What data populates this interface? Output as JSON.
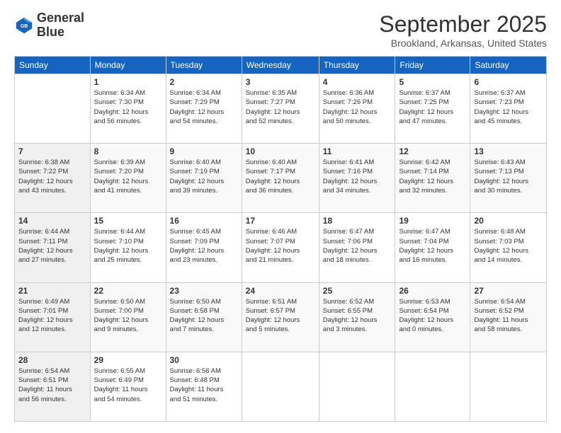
{
  "logo": {
    "line1": "General",
    "line2": "Blue"
  },
  "title": "September 2025",
  "location": "Brookland, Arkansas, United States",
  "days_of_week": [
    "Sunday",
    "Monday",
    "Tuesday",
    "Wednesday",
    "Thursday",
    "Friday",
    "Saturday"
  ],
  "weeks": [
    [
      {
        "day": "",
        "info": ""
      },
      {
        "day": "1",
        "info": "Sunrise: 6:34 AM\nSunset: 7:30 PM\nDaylight: 12 hours\nand 56 minutes."
      },
      {
        "day": "2",
        "info": "Sunrise: 6:34 AM\nSunset: 7:29 PM\nDaylight: 12 hours\nand 54 minutes."
      },
      {
        "day": "3",
        "info": "Sunrise: 6:35 AM\nSunset: 7:27 PM\nDaylight: 12 hours\nand 52 minutes."
      },
      {
        "day": "4",
        "info": "Sunrise: 6:36 AM\nSunset: 7:26 PM\nDaylight: 12 hours\nand 50 minutes."
      },
      {
        "day": "5",
        "info": "Sunrise: 6:37 AM\nSunset: 7:25 PM\nDaylight: 12 hours\nand 47 minutes."
      },
      {
        "day": "6",
        "info": "Sunrise: 6:37 AM\nSunset: 7:23 PM\nDaylight: 12 hours\nand 45 minutes."
      }
    ],
    [
      {
        "day": "7",
        "info": "Sunrise: 6:38 AM\nSunset: 7:22 PM\nDaylight: 12 hours\nand 43 minutes."
      },
      {
        "day": "8",
        "info": "Sunrise: 6:39 AM\nSunset: 7:20 PM\nDaylight: 12 hours\nand 41 minutes."
      },
      {
        "day": "9",
        "info": "Sunrise: 6:40 AM\nSunset: 7:19 PM\nDaylight: 12 hours\nand 39 minutes."
      },
      {
        "day": "10",
        "info": "Sunrise: 6:40 AM\nSunset: 7:17 PM\nDaylight: 12 hours\nand 36 minutes."
      },
      {
        "day": "11",
        "info": "Sunrise: 6:41 AM\nSunset: 7:16 PM\nDaylight: 12 hours\nand 34 minutes."
      },
      {
        "day": "12",
        "info": "Sunrise: 6:42 AM\nSunset: 7:14 PM\nDaylight: 12 hours\nand 32 minutes."
      },
      {
        "day": "13",
        "info": "Sunrise: 6:43 AM\nSunset: 7:13 PM\nDaylight: 12 hours\nand 30 minutes."
      }
    ],
    [
      {
        "day": "14",
        "info": "Sunrise: 6:44 AM\nSunset: 7:11 PM\nDaylight: 12 hours\nand 27 minutes."
      },
      {
        "day": "15",
        "info": "Sunrise: 6:44 AM\nSunset: 7:10 PM\nDaylight: 12 hours\nand 25 minutes."
      },
      {
        "day": "16",
        "info": "Sunrise: 6:45 AM\nSunset: 7:09 PM\nDaylight: 12 hours\nand 23 minutes."
      },
      {
        "day": "17",
        "info": "Sunrise: 6:46 AM\nSunset: 7:07 PM\nDaylight: 12 hours\nand 21 minutes."
      },
      {
        "day": "18",
        "info": "Sunrise: 6:47 AM\nSunset: 7:06 PM\nDaylight: 12 hours\nand 18 minutes."
      },
      {
        "day": "19",
        "info": "Sunrise: 6:47 AM\nSunset: 7:04 PM\nDaylight: 12 hours\nand 16 minutes."
      },
      {
        "day": "20",
        "info": "Sunrise: 6:48 AM\nSunset: 7:03 PM\nDaylight: 12 hours\nand 14 minutes."
      }
    ],
    [
      {
        "day": "21",
        "info": "Sunrise: 6:49 AM\nSunset: 7:01 PM\nDaylight: 12 hours\nand 12 minutes."
      },
      {
        "day": "22",
        "info": "Sunrise: 6:50 AM\nSunset: 7:00 PM\nDaylight: 12 hours\nand 9 minutes."
      },
      {
        "day": "23",
        "info": "Sunrise: 6:50 AM\nSunset: 6:58 PM\nDaylight: 12 hours\nand 7 minutes."
      },
      {
        "day": "24",
        "info": "Sunrise: 6:51 AM\nSunset: 6:57 PM\nDaylight: 12 hours\nand 5 minutes."
      },
      {
        "day": "25",
        "info": "Sunrise: 6:52 AM\nSunset: 6:55 PM\nDaylight: 12 hours\nand 3 minutes."
      },
      {
        "day": "26",
        "info": "Sunrise: 6:53 AM\nSunset: 6:54 PM\nDaylight: 12 hours\nand 0 minutes."
      },
      {
        "day": "27",
        "info": "Sunrise: 6:54 AM\nSunset: 6:52 PM\nDaylight: 11 hours\nand 58 minutes."
      }
    ],
    [
      {
        "day": "28",
        "info": "Sunrise: 6:54 AM\nSunset: 6:51 PM\nDaylight: 11 hours\nand 56 minutes."
      },
      {
        "day": "29",
        "info": "Sunrise: 6:55 AM\nSunset: 6:49 PM\nDaylight: 11 hours\nand 54 minutes."
      },
      {
        "day": "30",
        "info": "Sunrise: 6:56 AM\nSunset: 6:48 PM\nDaylight: 11 hours\nand 51 minutes."
      },
      {
        "day": "",
        "info": ""
      },
      {
        "day": "",
        "info": ""
      },
      {
        "day": "",
        "info": ""
      },
      {
        "day": "",
        "info": ""
      }
    ]
  ]
}
